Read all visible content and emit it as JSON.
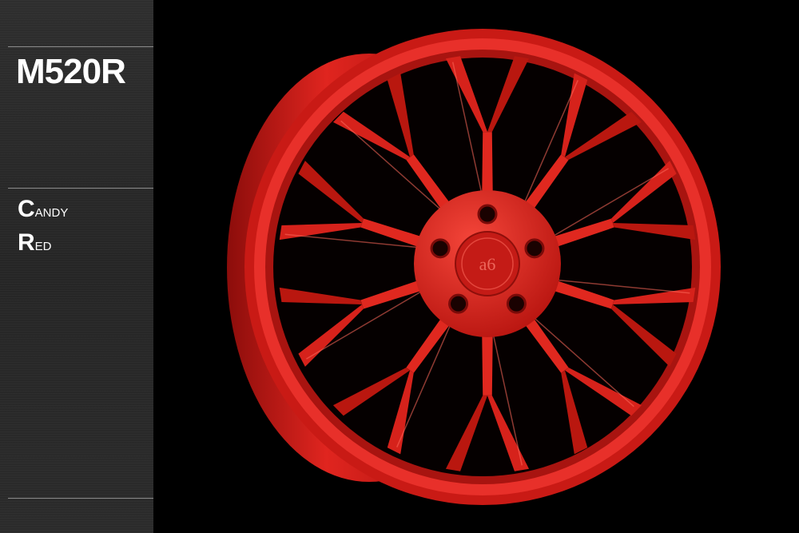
{
  "product": {
    "model": "M520R",
    "finish_line1_first": "C",
    "finish_line1_rest": "andy",
    "finish_line2_first": "R",
    "finish_line2_rest": "ed"
  },
  "colors": {
    "wheel_red": "#e0251f",
    "wheel_dark": "#8c0d0b",
    "sidebar": "#2a2a2a",
    "background": "#000000"
  },
  "image": {
    "subject": "wheel-photo",
    "spoke_count": 10,
    "lug_count": 5
  }
}
